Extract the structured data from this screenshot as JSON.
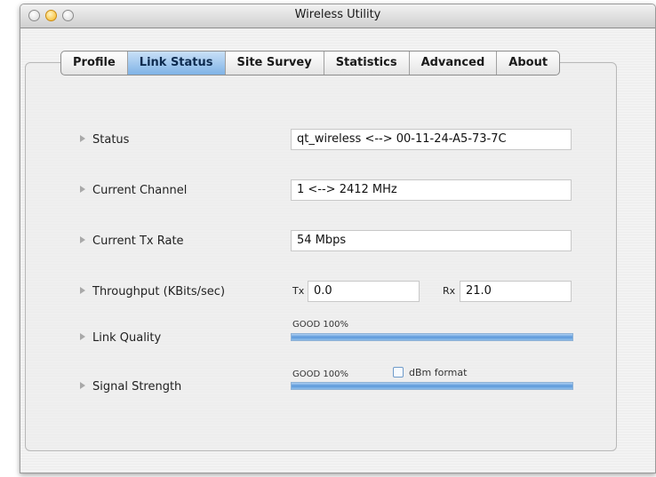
{
  "window": {
    "title": "Wireless Utility"
  },
  "tabs": [
    "Profile",
    "Link Status",
    "Site Survey",
    "Statistics",
    "Advanced",
    "About"
  ],
  "active_tab": "Link Status",
  "status": {
    "label": "Status",
    "value": "qt_wireless <--> 00-11-24-A5-73-7C"
  },
  "channel": {
    "label": "Current Channel",
    "value": "1 <--> 2412 MHz"
  },
  "tx_rate": {
    "label": "Current Tx Rate",
    "value": "54 Mbps"
  },
  "throughput": {
    "label": "Throughput (KBits/sec)",
    "tx_label": "Tx",
    "tx_value": "0.0",
    "rx_label": "Rx",
    "rx_value": "21.0"
  },
  "link_quality": {
    "label": "Link Quality",
    "caption": "GOOD 100%",
    "level": 1.0
  },
  "signal_strength": {
    "label": "Signal Strength",
    "caption": "GOOD 100%",
    "level": 1.0,
    "dbm_label": "dBm format",
    "dbm_checked": false
  },
  "colors": {
    "accent": "#5c99db",
    "tab_active": "#7fb3e6"
  }
}
